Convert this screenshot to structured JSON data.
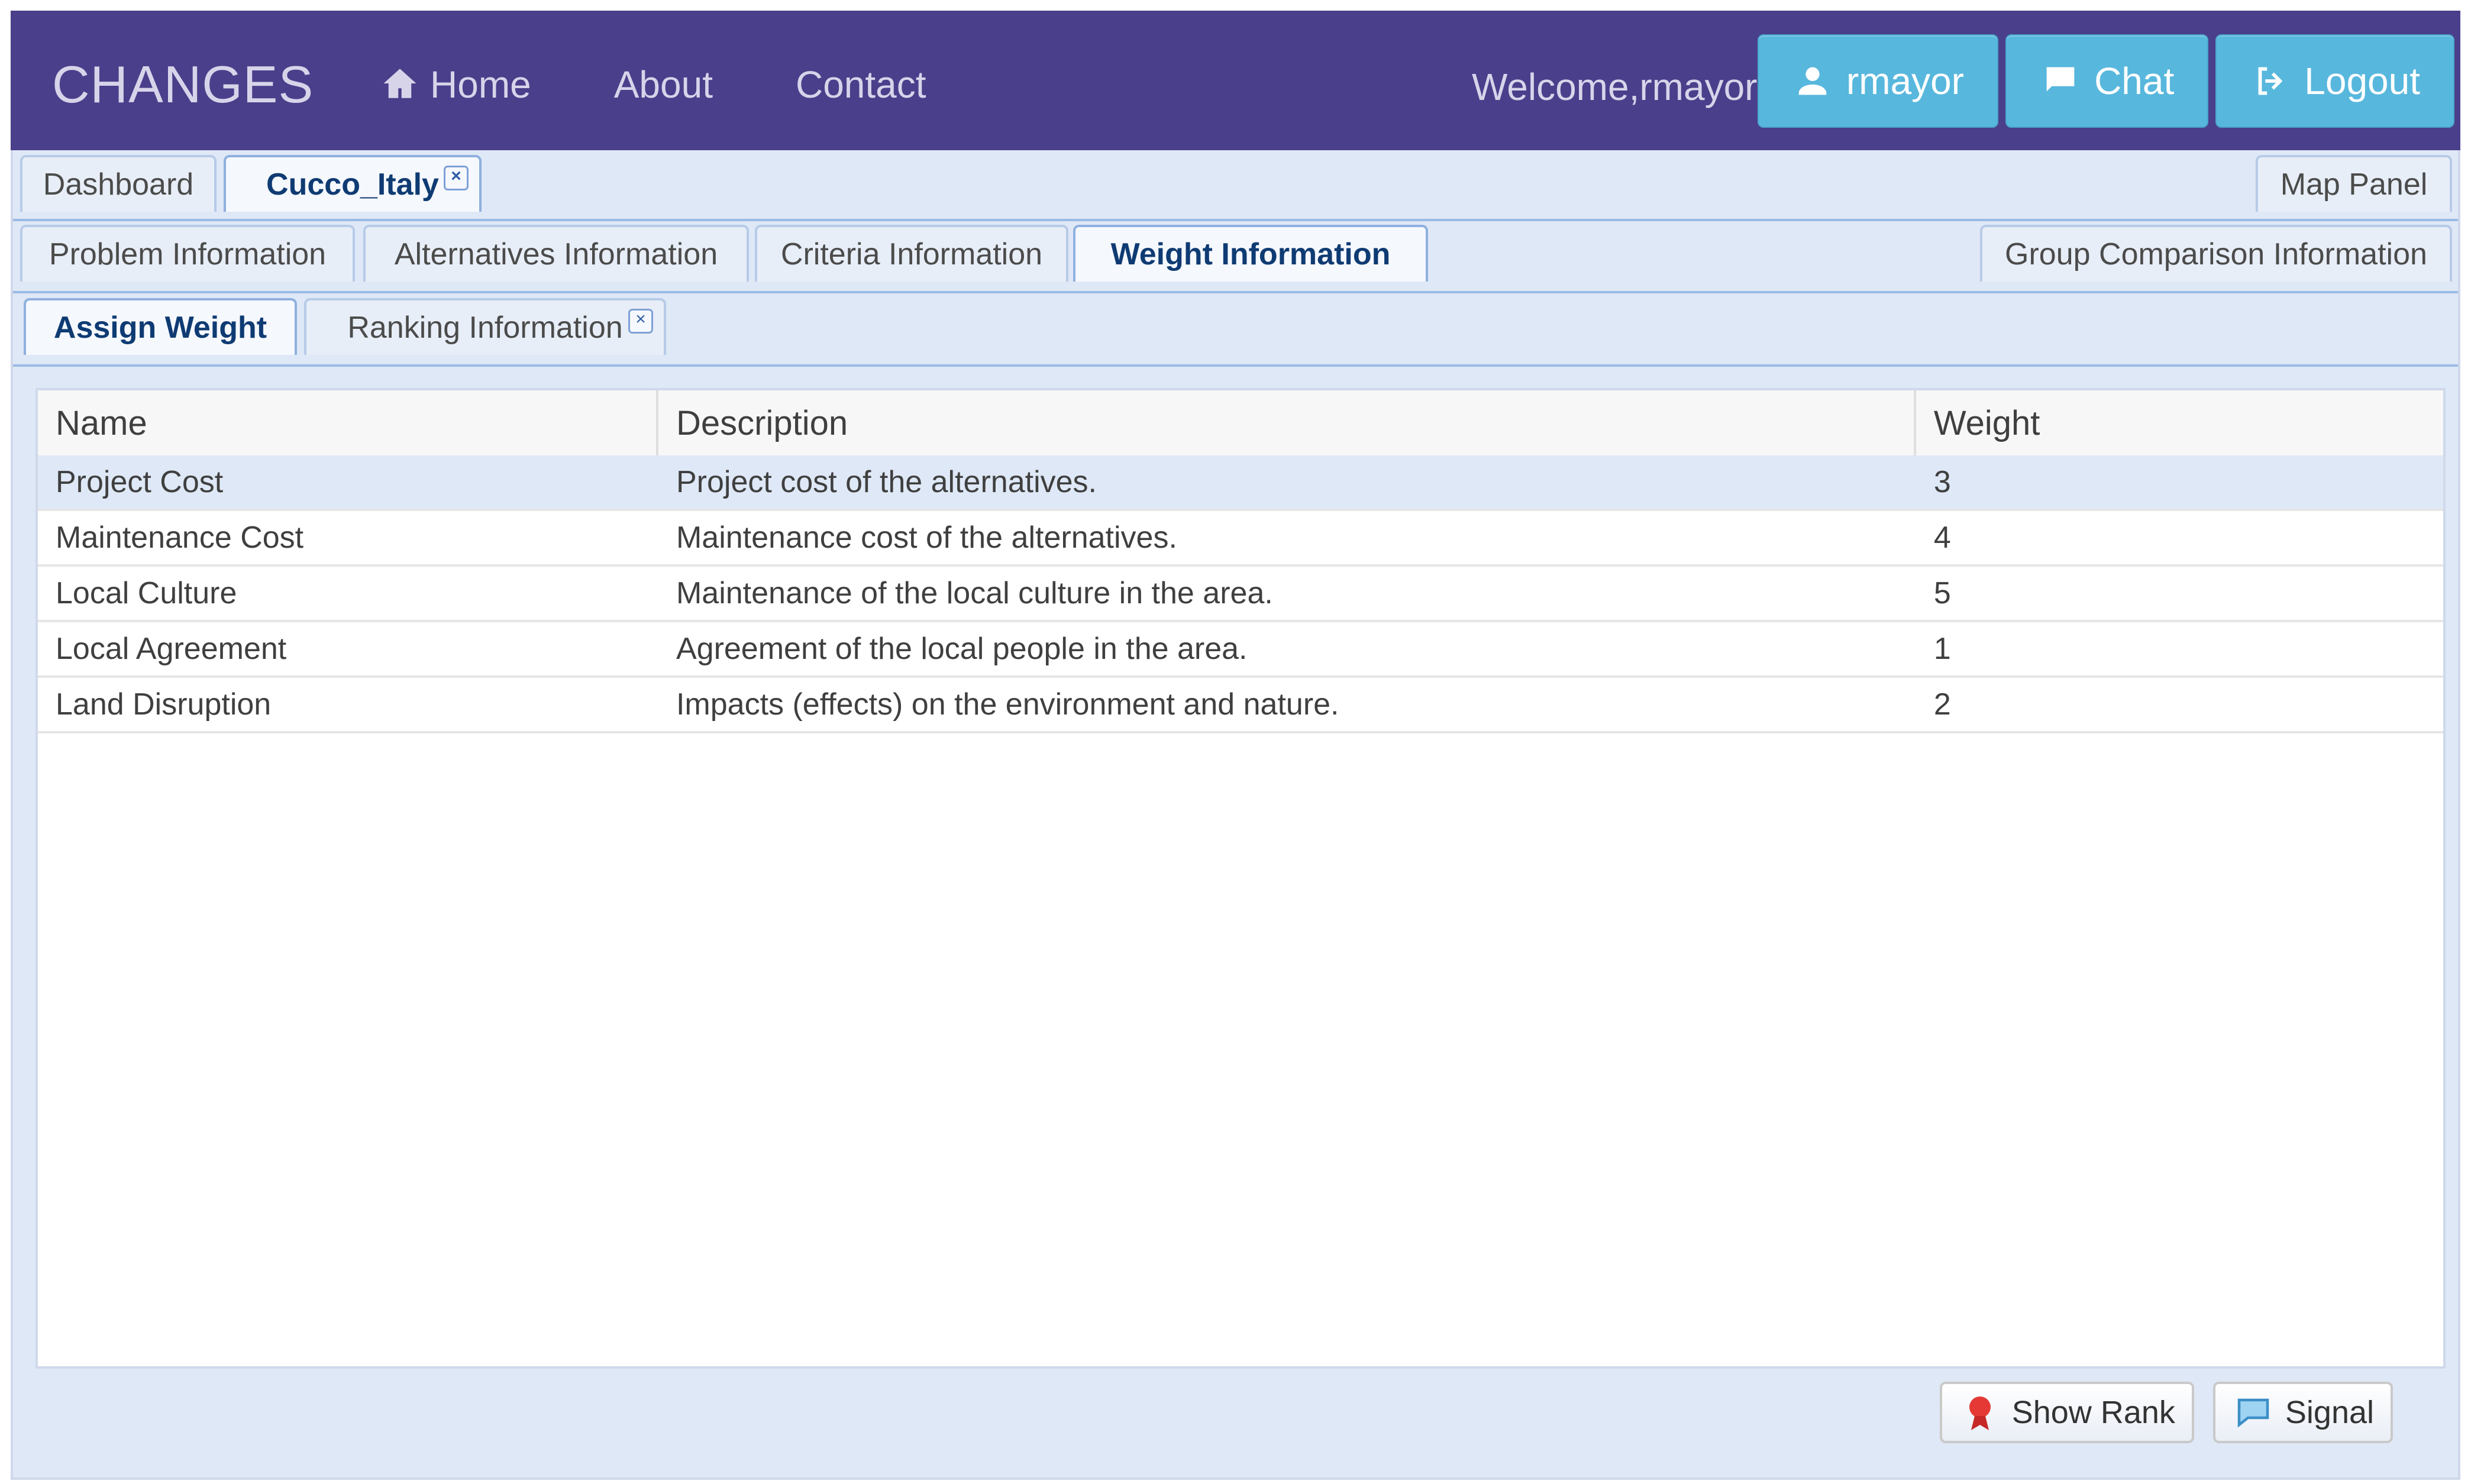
{
  "app": {
    "brand": "CHANGES",
    "nav": [
      {
        "label": "Home",
        "icon": "home-icon"
      },
      {
        "label": "About"
      },
      {
        "label": "Contact"
      }
    ],
    "welcome_text": "Welcome,rmayor!",
    "user_buttons": [
      {
        "label": "rmayor",
        "icon": "user-icon"
      },
      {
        "label": "Chat",
        "icon": "chat-icon"
      },
      {
        "label": "Logout",
        "icon": "logout-icon"
      }
    ]
  },
  "tabs": {
    "level1": {
      "left": [
        {
          "label": "Dashboard",
          "active": false
        },
        {
          "label": "Cucco_Italy",
          "active": true,
          "closable": true
        }
      ],
      "right": {
        "label": "Map Panel"
      }
    },
    "level2": {
      "left": [
        {
          "label": "Problem Information"
        },
        {
          "label": "Alternatives Information"
        },
        {
          "label": "Criteria Information"
        },
        {
          "label": "Weight Information",
          "active": true
        }
      ],
      "right": {
        "label": "Group Comparison Information"
      }
    },
    "level3": {
      "left": [
        {
          "label": "Assign Weight",
          "active": true
        },
        {
          "label": "Ranking Information",
          "closable": true
        }
      ]
    }
  },
  "grid": {
    "columns": [
      "Name",
      "Description",
      "Weight"
    ],
    "rows": [
      {
        "name": "Project Cost",
        "description": "Project cost of the alternatives.",
        "weight": "3",
        "selected": true
      },
      {
        "name": "Maintenance Cost",
        "description": "Maintenance cost of the alternatives.",
        "weight": "4"
      },
      {
        "name": "Local Culture",
        "description": "Maintenance of the local culture in the area.",
        "weight": "5"
      },
      {
        "name": "Local Agreement",
        "description": "Agreement of the local people in the area.",
        "weight": "1"
      },
      {
        "name": "Land Disruption",
        "description": "Impacts (effects) on the environment and nature.",
        "weight": "2"
      }
    ]
  },
  "actions": {
    "show_rank": {
      "label": "Show Rank",
      "icon": "ribbon-icon"
    },
    "signal": {
      "label": "Signal",
      "icon": "speech-bubble-icon"
    }
  },
  "colors": {
    "nav_bg": "#4a3f8b",
    "button_bg": "#58b7dd",
    "panel_bg": "#dfe8f6"
  }
}
